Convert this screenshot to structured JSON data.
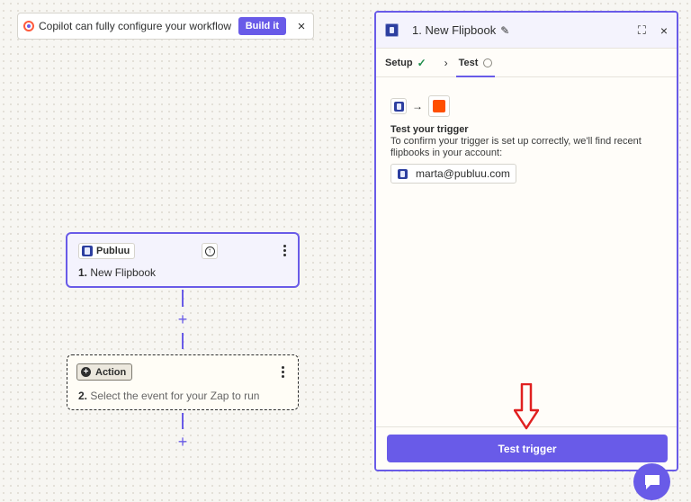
{
  "copilot": {
    "message": "Copilot can fully configure your workflow",
    "build_label": "Build it",
    "close_glyph": "×"
  },
  "trigger_step": {
    "app_name": "Publuu",
    "number": "1.",
    "title": "New Flipbook"
  },
  "action_step": {
    "badge": "Action",
    "number": "2.",
    "placeholder": "Select the event for your Zap to run"
  },
  "panel": {
    "title": "1. New Flipbook",
    "tabs": [
      {
        "label": "Setup",
        "status": "complete"
      },
      {
        "label": "Test",
        "status": "pending"
      }
    ],
    "test_heading": "Test your trigger",
    "test_description": "To confirm your trigger is set up correctly, we'll find recent flipbooks in your account:",
    "account": "marta@publuu.com",
    "test_button": "Test trigger"
  },
  "colors": {
    "accent": "#695be8",
    "success": "#1e8c4a",
    "target_app": "#ff4f00",
    "annotation": "#e02020"
  },
  "icons": [
    "copilot-icon",
    "close-icon",
    "publuu-logo-icon",
    "status-icon",
    "more-options-icon",
    "plus-icon",
    "action-icon",
    "pencil-icon",
    "expand-icon",
    "check-icon",
    "chevron-right-icon",
    "pending-circle-icon",
    "arrow-right-icon",
    "chat-icon"
  ]
}
